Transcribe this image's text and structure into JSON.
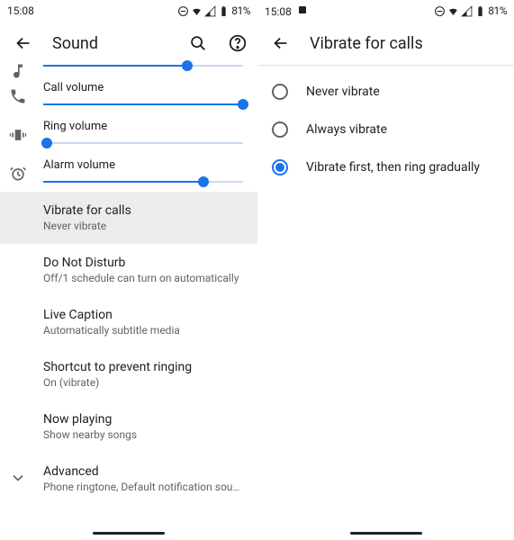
{
  "status": {
    "time": "15:08",
    "battery_text": "81%"
  },
  "left": {
    "title": "Sound",
    "sliders": {
      "media": {
        "label": "",
        "percent": 72
      },
      "call": {
        "label": "Call volume",
        "percent": 100
      },
      "ring": {
        "label": "Ring volume",
        "percent": 2
      },
      "alarm": {
        "label": "Alarm volume",
        "percent": 80
      }
    },
    "items": {
      "vibrate": {
        "title": "Vibrate for calls",
        "sub": "Never vibrate"
      },
      "dnd": {
        "title": "Do Not Disturb",
        "sub": "Off/1 schedule can turn on automatically"
      },
      "caption": {
        "title": "Live Caption",
        "sub": "Automatically subtitle media"
      },
      "shortcut": {
        "title": "Shortcut to prevent ringing",
        "sub": "On (vibrate)"
      },
      "nowplaying": {
        "title": "Now playing",
        "sub": "Show nearby songs"
      },
      "advanced": {
        "title": "Advanced",
        "sub": "Phone ringtone, Default notification sound, Def…"
      }
    }
  },
  "right": {
    "title": "Vibrate for calls",
    "options": {
      "never": "Never vibrate",
      "always": "Always vibrate",
      "gradual": "Vibrate first, then ring gradually"
    },
    "selected": "gradual"
  }
}
